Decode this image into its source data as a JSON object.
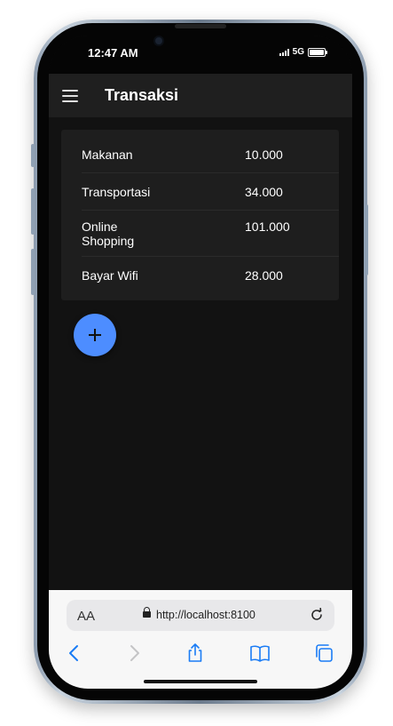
{
  "status_bar": {
    "time": "12:47 AM",
    "network": "5G"
  },
  "app": {
    "title": "Transaksi"
  },
  "transactions": [
    {
      "label": "Makanan",
      "amount": "10.000"
    },
    {
      "label": "Transportasi",
      "amount": "34.000"
    },
    {
      "label": "Online Shopping",
      "amount": "101.000"
    },
    {
      "label": "Bayar Wifi",
      "amount": "28.000"
    }
  ],
  "browser": {
    "text_size_label": "AA",
    "url": "http://localhost:8100"
  },
  "colors": {
    "fab": "#4d8dff",
    "ios_blue": "#1a7cf5",
    "toolbar": "#1f1f1f",
    "background": "#121212"
  },
  "icons": [
    "menu-icon",
    "plus-icon",
    "lock-icon",
    "reload-icon",
    "back-icon",
    "forward-icon",
    "share-icon",
    "bookmarks-icon",
    "tabs-icon"
  ]
}
